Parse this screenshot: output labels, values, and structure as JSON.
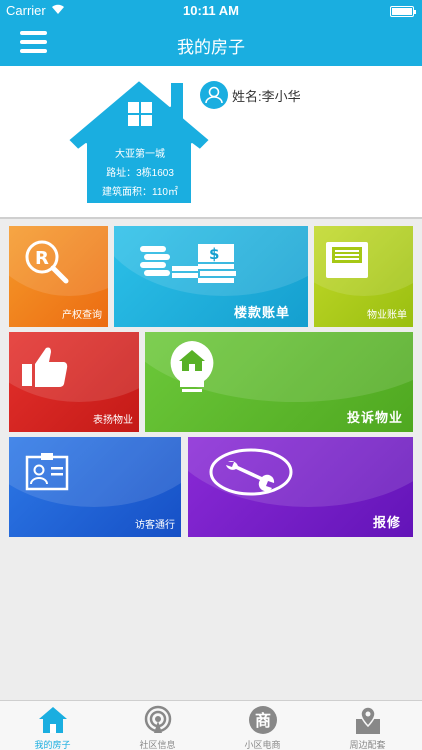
{
  "status_bar": {
    "carrier": "Carrier",
    "time": "10:11 AM"
  },
  "nav": {
    "title": "我的房子"
  },
  "house": {
    "name": "大亚第一城",
    "address": "路址：3栋1603",
    "area": "建筑面积：110㎡",
    "owner": "姓名:李小华"
  },
  "tiles": {
    "property_query": "产权查询",
    "payment_bill": "楼款账单",
    "property_bill": "物业账单",
    "praise": "表扬物业",
    "complaint": "投诉物业",
    "visitor": "访客通行",
    "repair": "报修"
  },
  "tabbar": {
    "items": [
      {
        "label": "我的房子",
        "active": true,
        "icon": "house-icon"
      },
      {
        "label": "社区信息",
        "active": false,
        "icon": "broadcast-icon"
      },
      {
        "label": "小区电商",
        "active": false,
        "icon": "shop-icon",
        "glyph": "商"
      },
      {
        "label": "周边配套",
        "active": false,
        "icon": "map-pin-icon"
      }
    ]
  },
  "colors": {
    "primary": "#1aaee0",
    "tile_orange": "#f07f1c",
    "tile_cyan": "#1ab0dc",
    "tile_lime": "#a8c914",
    "tile_red": "#d8231f",
    "tile_green": "#5cb82a",
    "tile_blue": "#1f62d6",
    "tile_purple": "#7a1ec8"
  }
}
